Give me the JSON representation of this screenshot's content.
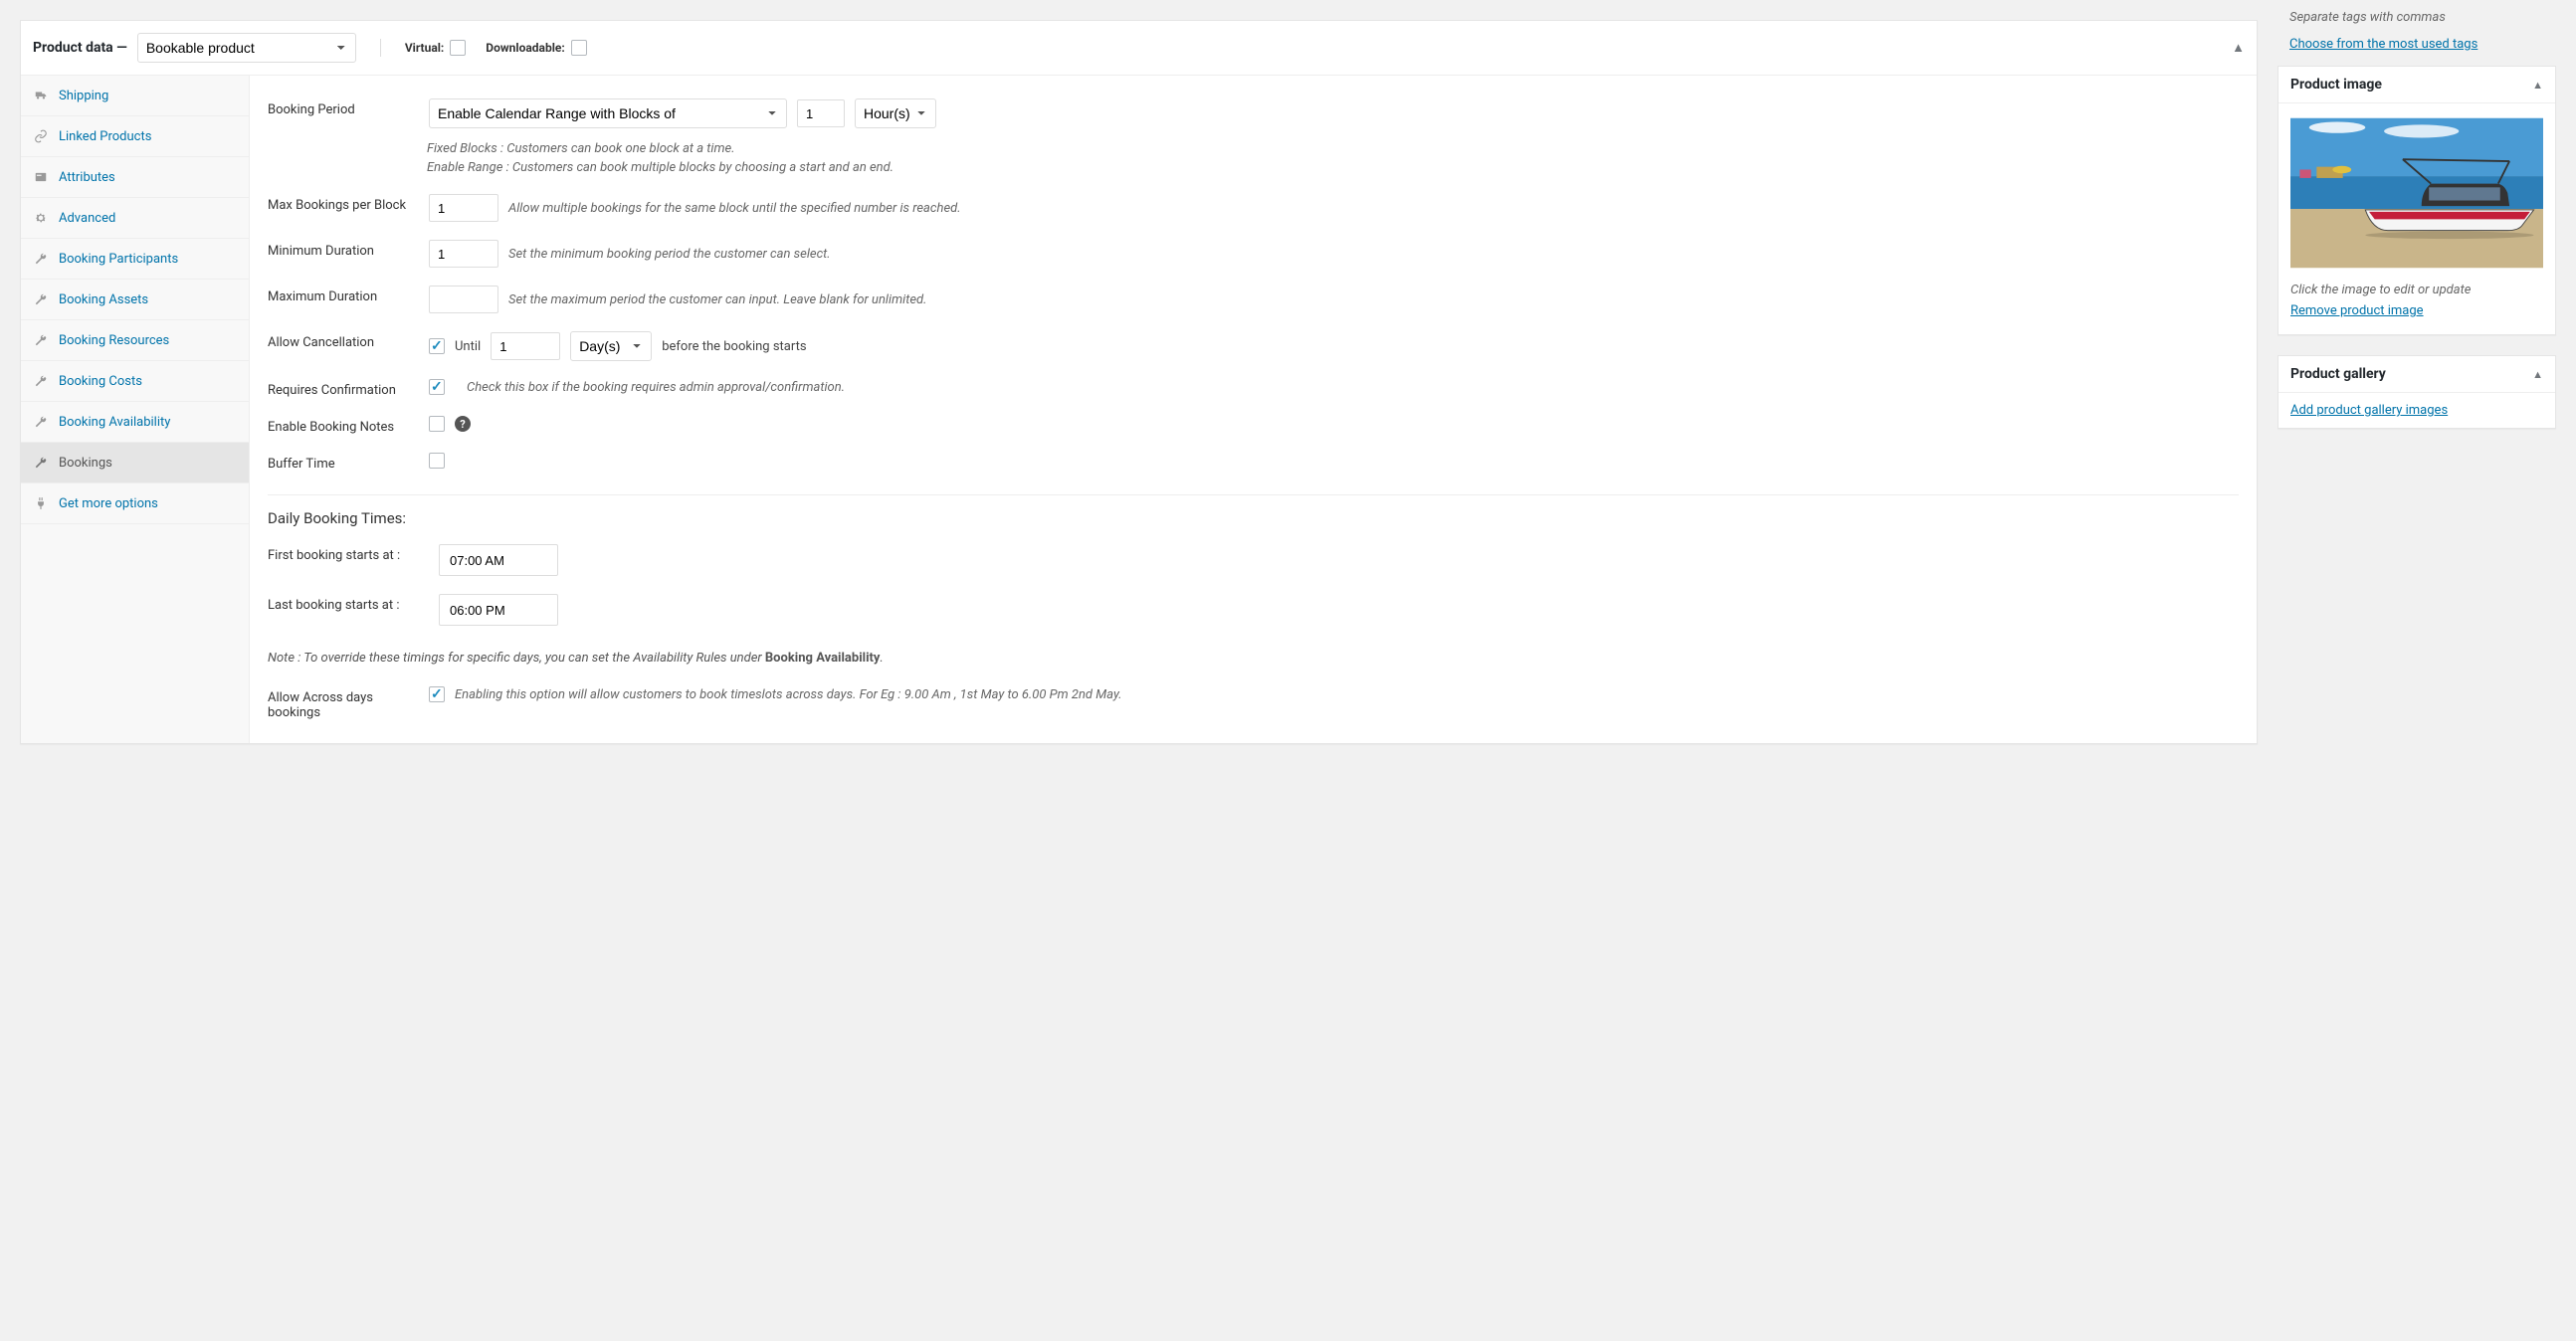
{
  "productData": {
    "title": "Product data —",
    "typeSelected": "Bookable product",
    "virtualLabel": "Virtual:",
    "virtualChecked": false,
    "downloadableLabel": "Downloadable:",
    "downloadableChecked": false
  },
  "sidebar": {
    "items": [
      {
        "id": "shipping",
        "label": "Shipping",
        "icon": "truck"
      },
      {
        "id": "linked",
        "label": "Linked Products",
        "icon": "link"
      },
      {
        "id": "attributes",
        "label": "Attributes",
        "icon": "card"
      },
      {
        "id": "advanced",
        "label": "Advanced",
        "icon": "gear"
      },
      {
        "id": "participants",
        "label": "Booking Participants",
        "icon": "wrench"
      },
      {
        "id": "assets",
        "label": "Booking Assets",
        "icon": "wrench"
      },
      {
        "id": "resources",
        "label": "Booking Resources",
        "icon": "wrench"
      },
      {
        "id": "costs",
        "label": "Booking Costs",
        "icon": "wrench"
      },
      {
        "id": "availability",
        "label": "Booking Availability",
        "icon": "wrench"
      },
      {
        "id": "bookings",
        "label": "Bookings",
        "icon": "wrench",
        "active": true
      },
      {
        "id": "more",
        "label": "Get more options",
        "icon": "plug"
      }
    ]
  },
  "bookings": {
    "periodLabel": "Booking Period",
    "periodSelected": "Enable Calendar Range with Blocks of",
    "periodQty": "1",
    "periodUnitSelected": "Hour(s)",
    "periodHelp1": "Fixed Blocks : Customers can book one block at a time.",
    "periodHelp2": "Enable Range : Customers can book multiple blocks by choosing a start and an end.",
    "maxBookingsLabel": "Max Bookings per Block",
    "maxBookingsValue": "1",
    "maxBookingsHelp": "Allow multiple bookings for the same block until the specified number is reached.",
    "minDurationLabel": "Minimum Duration",
    "minDurationValue": "1",
    "minDurationHelp": "Set the minimum booking period the customer can select.",
    "maxDurationLabel": "Maximum Duration",
    "maxDurationValue": "",
    "maxDurationHelp": "Set the maximum period the customer can input. Leave blank for unlimited.",
    "allowCancellationLabel": "Allow Cancellation",
    "allowCancellationChecked": true,
    "untilLabel": "Until",
    "cancelValue": "1",
    "cancelUnitSelected": "Day(s)",
    "cancelSuffix": "before the booking starts",
    "requiresConfirmationLabel": "Requires Confirmation",
    "requiresConfirmationChecked": true,
    "requiresConfirmationHelp": "Check this box if the booking requires admin approval/confirmation.",
    "enableNotesLabel": "Enable Booking Notes",
    "enableNotesChecked": false,
    "bufferTimeLabel": "Buffer Time",
    "bufferTimeChecked": false,
    "dailyTimesTitle": "Daily Booking Times:",
    "firstBookingLabel": "First booking starts at :",
    "firstBookingValue": "07:00 AM",
    "lastBookingLabel": "Last booking starts at :",
    "lastBookingValue": "06:00 PM",
    "notePrefix": "Note : To override these timings for specific days, you can set the Availability Rules under ",
    "noteBold": "Booking Availability",
    "noteSuffix": ".",
    "allowAcrossLabel": "Allow Across days bookings",
    "allowAcrossChecked": true,
    "allowAcrossHelp": "Enabling this option will allow customers to book timeslots across days. For Eg : 9.00 Am , 1st May to 6.00 Pm 2nd May."
  },
  "tags": {
    "separateHint": "Separate tags with commas",
    "chooseLink": "Choose from the most used tags"
  },
  "productImage": {
    "title": "Product image",
    "editHint": "Click the image to edit or update",
    "removeLink": "Remove product image"
  },
  "productGallery": {
    "title": "Product gallery",
    "addLink": "Add product gallery images"
  }
}
